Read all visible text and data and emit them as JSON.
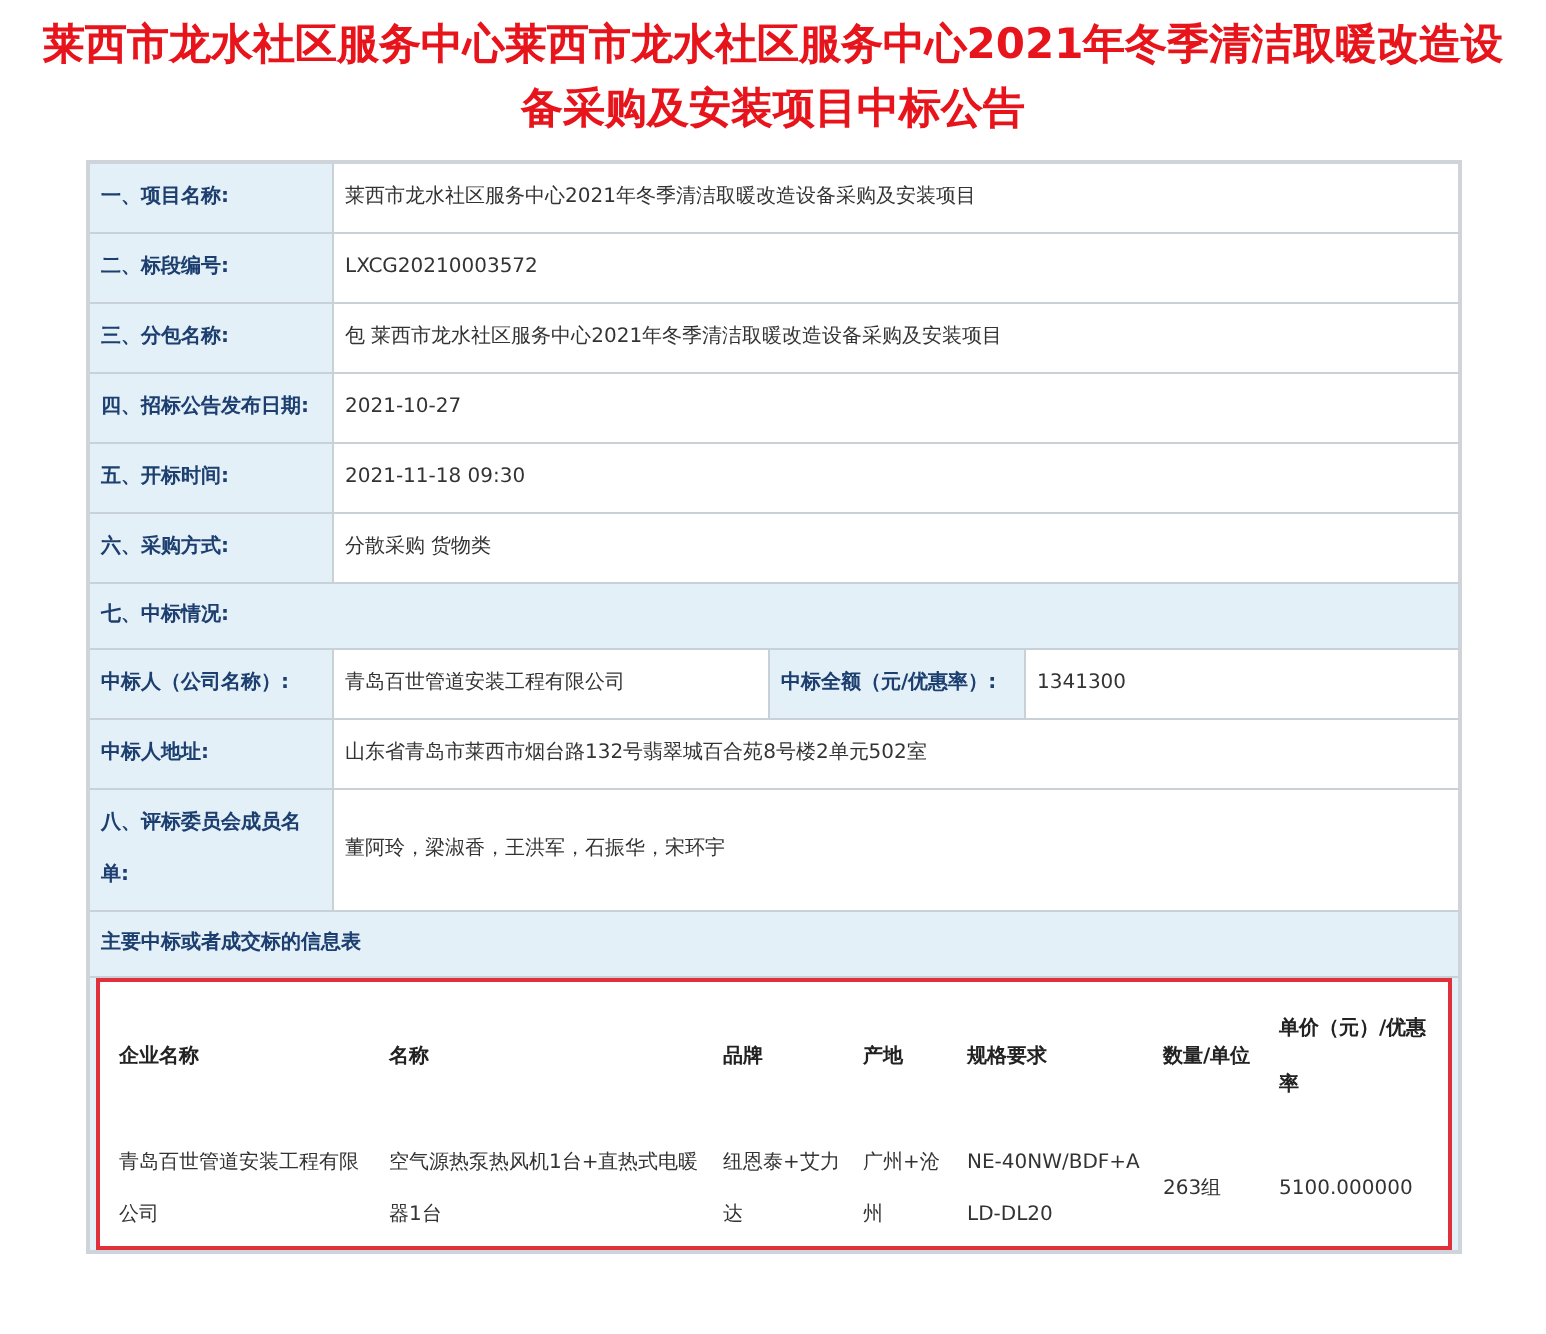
{
  "title": "莱西市龙水社区服务中心莱西市龙水社区服务中心2021年冬季清洁取暖改造设备采购及安装项目中标公告",
  "fields": [
    {
      "label": "一、项目名称:",
      "value": "莱西市龙水社区服务中心2021年冬季清洁取暖改造设备采购及安装项目"
    },
    {
      "label": "二、标段编号:",
      "value": "LXCG20210003572"
    },
    {
      "label": "三、分包名称:",
      "value": "包 莱西市龙水社区服务中心2021年冬季清洁取暖改造设备采购及安装项目"
    },
    {
      "label": "四、招标公告发布日期:",
      "value": "2021-10-27"
    },
    {
      "label": "五、开标时间:",
      "value": "2021-11-18 09:30"
    },
    {
      "label": "六、采购方式:",
      "value": "分散采购 货物类"
    }
  ],
  "section_7": "七、中标情况:",
  "winner": {
    "label": "中标人（公司名称）:",
    "value": "青岛百世管道安装工程有限公司",
    "amount_label": "中标全额（元/优惠率）:",
    "amount": "1341300"
  },
  "address": {
    "label": "中标人地址:",
    "value": "山东省青岛市莱西市烟台路132号翡翠城百合苑8号楼2单元502室"
  },
  "committee": {
    "label": "八、评标委员会成员名单:",
    "value": "董阿玲，梁淑香，王洪军，石振华，宋环宇"
  },
  "info_table": {
    "title": "主要中标或者成交标的信息表",
    "columns": [
      "企业名称",
      "名称",
      "品牌",
      "产地",
      "规格要求",
      "数量/单位",
      "单价（元）/优惠率"
    ],
    "rows": [
      [
        "青岛百世管道安装工程有限公司",
        "空气源热泵热风机1台+直热式电暖器1台",
        "纽恩泰+艾力达",
        "广州+沧州",
        "NE-40NW/BDF+ALD-DL20",
        "263组",
        "5100.000000"
      ]
    ]
  }
}
